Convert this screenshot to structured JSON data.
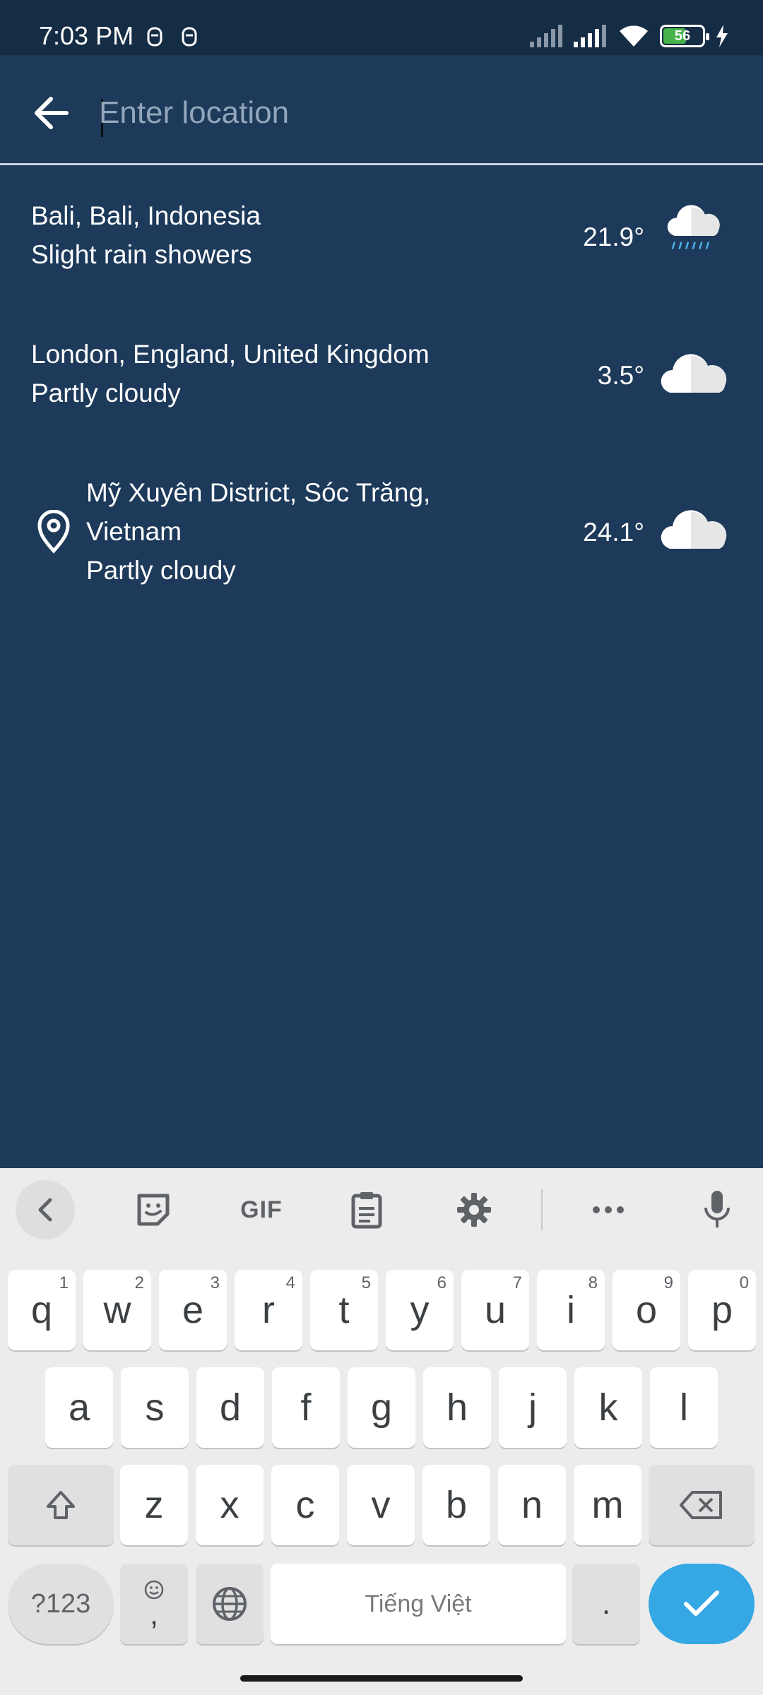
{
  "status_bar": {
    "time": "7:03 PM",
    "battery": "56",
    "battery_level": 0.56,
    "icons": [
      "notification-icon",
      "notification-icon",
      "signal-icon",
      "signal-icon",
      "wifi-icon",
      "battery-icon",
      "charging-icon"
    ]
  },
  "search": {
    "placeholder": "Enter location",
    "value": ""
  },
  "results": [
    {
      "name": "Bali, Bali, Indonesia",
      "condition": "Slight rain showers",
      "temperature": "21.9°",
      "icon": "rain-cloud-icon"
    },
    {
      "name": "London, England, United Kingdom",
      "condition": "Partly cloudy",
      "temperature": "3.5°",
      "icon": "cloud-icon"
    },
    {
      "name_line1": "Mỹ Xuyên District, Sóc Trăng,",
      "name_line2": "Vietnam",
      "condition": "Partly cloudy",
      "temperature": "24.1°",
      "icon": "cloud-icon",
      "leading_icon": "location-pin-icon"
    }
  ],
  "keyboard": {
    "toolbar": {
      "gif_label": "GIF",
      "items": [
        "collapse-icon",
        "sticker-icon",
        "gif",
        "clipboard-icon",
        "settings-icon",
        "more-icon",
        "mic-icon"
      ]
    },
    "row1": [
      {
        "key": "q",
        "alt": "1"
      },
      {
        "key": "w",
        "alt": "2"
      },
      {
        "key": "e",
        "alt": "3"
      },
      {
        "key": "r",
        "alt": "4"
      },
      {
        "key": "t",
        "alt": "5"
      },
      {
        "key": "y",
        "alt": "6"
      },
      {
        "key": "u",
        "alt": "7"
      },
      {
        "key": "i",
        "alt": "8"
      },
      {
        "key": "o",
        "alt": "9"
      },
      {
        "key": "p",
        "alt": "0"
      }
    ],
    "row2": [
      "a",
      "s",
      "d",
      "f",
      "g",
      "h",
      "j",
      "k",
      "l"
    ],
    "row3": [
      "z",
      "x",
      "c",
      "v",
      "b",
      "n",
      "m"
    ],
    "symbols_label": "?123",
    "comma_label": ",",
    "space_label": "Tiếng Việt",
    "period_label": "."
  },
  "colors": {
    "background": "#1d3a5a",
    "status_bar": "#152c45",
    "enter_key": "#35a7e5",
    "keyboard_bg": "#ececec"
  }
}
